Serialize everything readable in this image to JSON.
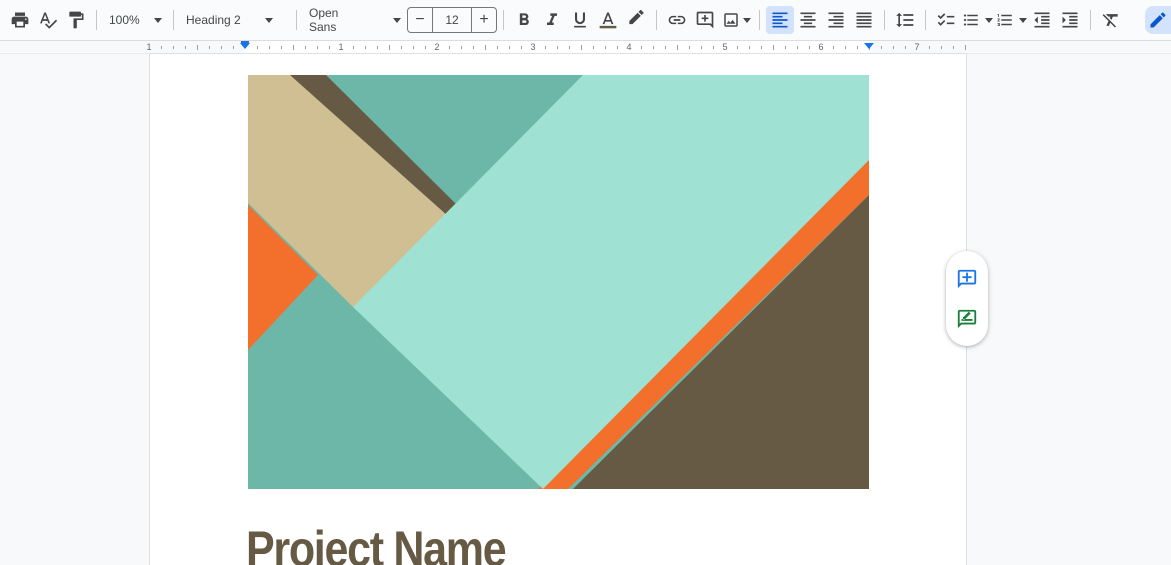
{
  "toolbar": {
    "zoom": "100%",
    "paragraph_style": "Heading 2",
    "font": "Open Sans",
    "font_size": "12",
    "decrease_label": "−",
    "increase_label": "+"
  },
  "ruler": {
    "numbers": [
      "1",
      "1",
      "2",
      "3",
      "4",
      "5",
      "6",
      "7"
    ]
  },
  "document": {
    "title": "Project Name",
    "cover_image_colors": {
      "teal_dark": "#6db7a8",
      "teal_light": "#9fe2d4",
      "tan": "#cfbf92",
      "brown": "#665a44",
      "orange": "#f36f2c"
    }
  },
  "colors": {
    "accent_blue": "#1a73e8",
    "title_color": "#665a44",
    "text_color_underline": "#665a44"
  },
  "icons": {
    "side_add_comment": "add-comment-icon",
    "side_suggest_edit": "suggest-edit-icon"
  }
}
